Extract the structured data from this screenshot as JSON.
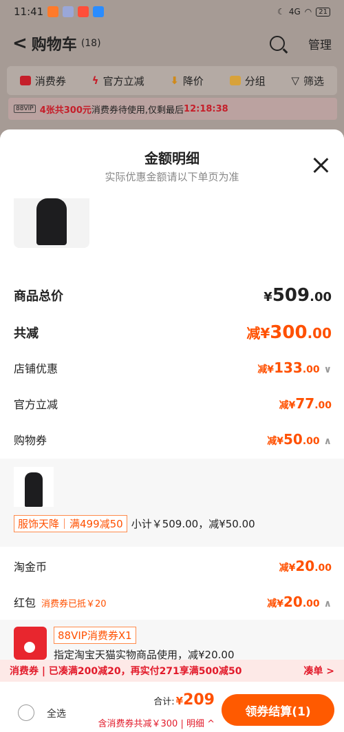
{
  "status": {
    "time": "11:41",
    "network": "4G",
    "battery": "21"
  },
  "header": {
    "back": "<",
    "title": "购物车",
    "count": "(18)",
    "manage": "管理"
  },
  "filters": {
    "items": [
      "消费券",
      "官方立减",
      "降价",
      "分组",
      "筛选"
    ],
    "filter_icon": "▽"
  },
  "vip_banner": {
    "tag": "88VIP",
    "highlight": "4张共300元",
    "text": "消费券待使用,仅剩最后",
    "timer": "12:18:38"
  },
  "sheet": {
    "title": "金额明细",
    "subtitle": "实际优惠金额请以下单页为准",
    "rows": {
      "total_label": "商品总价",
      "total_cur": "¥",
      "total_int": "509",
      "total_dec": ".00",
      "reduce_label": "共减",
      "reduce_pre": "减¥",
      "reduce_int": "300",
      "reduce_dec": ".00",
      "shop_label": "店铺优惠",
      "shop_pre": "减¥",
      "shop_int": "133",
      "shop_dec": ".00",
      "shop_chev": "∨",
      "official_label": "官方立减",
      "official_pre": "减¥",
      "official_int": "77",
      "official_dec": ".00",
      "voucher_label": "购物券",
      "voucher_pre": "减¥",
      "voucher_int": "50",
      "voucher_dec": ".00",
      "voucher_chev": "∧",
      "coin_label": "淘金币",
      "coin_pre": "减¥",
      "coin_int": "20",
      "coin_dec": ".00",
      "hongbao_label": "红包",
      "hongbao_note": "消费券已抵￥20",
      "hongbao_pre": "减¥",
      "hongbao_int": "20",
      "hongbao_dec": ".00",
      "hongbao_chev": "∧"
    },
    "voucher_detail": {
      "tag": "服饰天降｜满499减50",
      "subtotal": "小计￥509.00，减¥50.00"
    },
    "hongbao_detail": {
      "tag": "88VIP消费券X1",
      "desc": "指定淘宝天猫实物商品使用，减¥20.00"
    }
  },
  "promo": {
    "text": "消费券 | 已凑满200减20，再实付271享满500减50",
    "more": "凑单 >"
  },
  "footer": {
    "select_all": "全选",
    "total_label": "合计:",
    "total_cur": "¥",
    "total_value": "209",
    "saved": "含消费券共减￥300 | 明细 ^",
    "checkout": "领券结算(1)"
  },
  "colors": {
    "accent": "#ff5000",
    "promo_red": "#e21a2a"
  }
}
